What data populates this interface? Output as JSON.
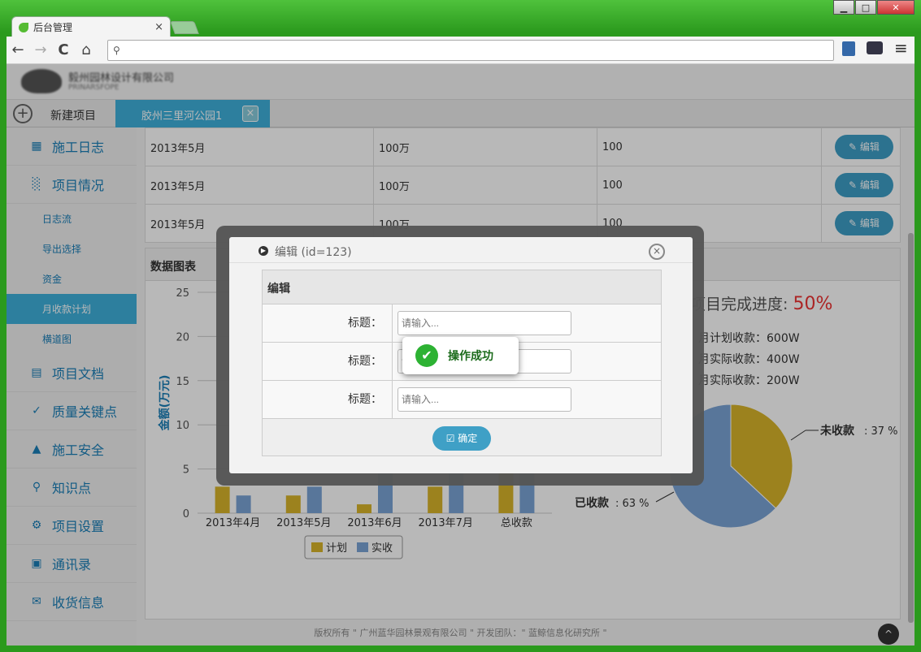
{
  "browser": {
    "tab_title": "后台管理",
    "tab_close": "×",
    "address": "",
    "nav_back": "←",
    "nav_forward": "→",
    "nav_reload": "C",
    "nav_home": "⌂",
    "menu": "≡"
  },
  "window": {
    "min": "▁",
    "max": "□",
    "close": "✕"
  },
  "header": {
    "company": "毅州园林设计有限公司",
    "company_sub": "PRINARSFOPE"
  },
  "tabs": {
    "add": "+",
    "new_project": "新建项目",
    "project": "胶州三里河公园1",
    "project_close": "×"
  },
  "sidebar": {
    "items": [
      {
        "label": "施工日志",
        "icon": "calendar-icon"
      },
      {
        "label": "项目情况",
        "icon": "bar-chart-icon"
      }
    ],
    "sub": [
      "日志流",
      "导出选择",
      "资金",
      "月收款计划",
      "横道图"
    ],
    "items2": [
      {
        "label": "项目文档",
        "icon": "document-icon"
      },
      {
        "label": "质量关键点",
        "icon": "check-icon"
      },
      {
        "label": "施工安全",
        "icon": "warning-icon"
      },
      {
        "label": "知识点",
        "icon": "search-icon"
      },
      {
        "label": "项目设置",
        "icon": "gear-icon"
      },
      {
        "label": "通讯录",
        "icon": "contacts-icon"
      },
      {
        "label": "收货信息",
        "icon": "mail-icon"
      }
    ]
  },
  "table": {
    "rows": [
      {
        "date": "2013年5月",
        "amount": "100万",
        "value": "100",
        "edit": "编辑"
      },
      {
        "date": "2013年5月",
        "amount": "100万",
        "value": "100",
        "edit": "编辑"
      },
      {
        "date": "2013年5月",
        "amount": "100万",
        "value": "100",
        "edit": "编辑"
      }
    ]
  },
  "chart_panel": {
    "title": "数据图表"
  },
  "progress": {
    "label": "项目完成进度:",
    "pct": "50%",
    "lines": [
      "月计划收款：600W",
      "月实际收款：400W",
      "月实际收款：200W"
    ]
  },
  "chart_data": [
    {
      "type": "bar",
      "categories": [
        "2013年4月",
        "2013年5月",
        "2013年6月",
        "2013年7月",
        "总收款"
      ],
      "series": [
        {
          "name": "计划",
          "values": [
            3,
            2,
            1,
            3,
            9
          ],
          "color": "#d8b52a"
        },
        {
          "name": "实收",
          "values": [
            2,
            3,
            5,
            7,
            9
          ],
          "color": "#7ba4d6"
        }
      ],
      "ylabel": "金额(万元)",
      "ylim": [
        0,
        25
      ],
      "yticks": [
        0,
        5,
        10,
        15,
        20,
        25
      ],
      "legend": "bottom"
    },
    {
      "type": "pie",
      "slices": [
        {
          "name": "未收款",
          "pct": 37,
          "label": "37 %",
          "color": "#d8b52a"
        },
        {
          "name": "已收款",
          "pct": 63,
          "label": "63 %",
          "color": "#7ba4d6"
        }
      ]
    }
  ],
  "modal": {
    "title": "编辑",
    "id_text": "(id=123)",
    "close": "×",
    "section": "编辑",
    "label": "标题：",
    "placeholder": "请输入...",
    "ok": "确定"
  },
  "toast": {
    "text": "操作成功",
    "icon": "✔"
  },
  "footer": {
    "text": "版权所有 \" 广州蓝华园林景观有限公司 \"      开发团队：\" 蓝鲸信息化研究所 \"",
    "totop": "^"
  }
}
